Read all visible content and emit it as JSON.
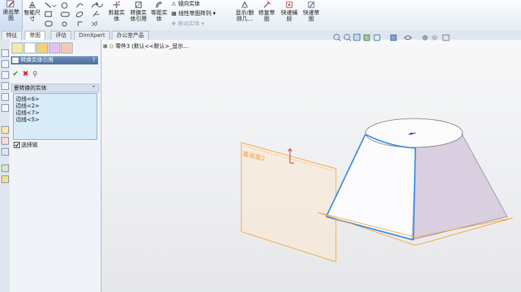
{
  "ribbon": {
    "exit_sketch": "退出草\n图",
    "smart_dim": "智能尺\n寸",
    "trim": "剪裁实\n体",
    "convert": "转换实\n体引用",
    "offset": "等距实\n体",
    "mirror": "镜向实体",
    "linear_pattern": "线性草图阵列",
    "move_entity": "移动实体",
    "show_delete": "显示/删\n除几...",
    "repair": "修复草\n图",
    "quick_snap": "快速捕\n捉",
    "rapid_sketch": "快速草\n图"
  },
  "tabs": [
    "特征",
    "草图",
    "评估",
    "DimXpert",
    "办公室产品"
  ],
  "active_tab": 1,
  "property": {
    "title": "转换实体引用",
    "help": "?",
    "group_title": "要转换的实体",
    "edges": [
      "边线<6>",
      "边线<2>",
      "边线<7>",
      "边线<5>"
    ],
    "select_chain": "选择链",
    "select_chain_checked": true
  },
  "tree": {
    "part": "零件3  (默认<<默认>_显示..."
  },
  "scene": {
    "plane_label": "基准面2",
    "sketch_color": "#f3a53a",
    "edge_color": "#3a8de0"
  }
}
